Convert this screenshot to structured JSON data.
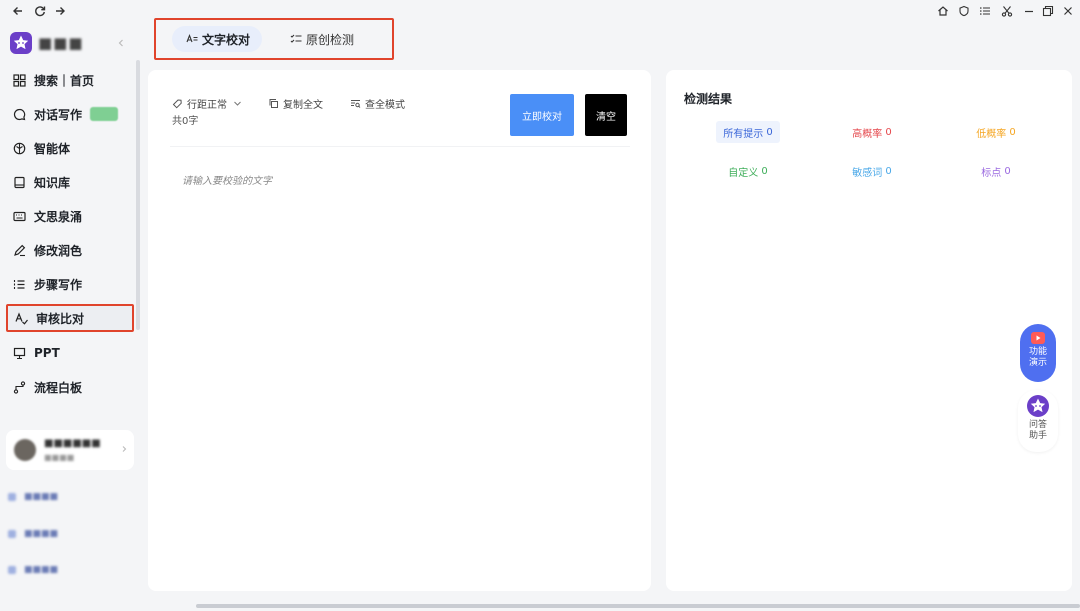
{
  "sidebar": {
    "items": [
      {
        "label": "搜索｜首页",
        "icon": "grid-icon"
      },
      {
        "label": "对话写作",
        "icon": "chat-icon"
      },
      {
        "label": "智能体",
        "icon": "globe-icon"
      },
      {
        "label": "知识库",
        "icon": "book-icon"
      },
      {
        "label": "文思泉涌",
        "icon": "keyboard-icon"
      },
      {
        "label": "修改润色",
        "icon": "pen-icon"
      },
      {
        "label": "步骤写作",
        "icon": "list-icon"
      },
      {
        "label": "审核比对",
        "icon": "text-check-icon"
      },
      {
        "label": "PPT",
        "icon": "presentation-icon"
      },
      {
        "label": "流程白板",
        "icon": "flow-icon"
      }
    ]
  },
  "tabs": [
    {
      "label": "文字校对",
      "icon": "text-check-icon",
      "active": true
    },
    {
      "label": "原创检测",
      "icon": "checklist-icon",
      "active": false
    }
  ],
  "editor": {
    "line_spacing": "行距正常",
    "copy_all": "复制全文",
    "check_mode": "查全模式",
    "word_count": "共0字",
    "check_button": "立即校对",
    "clear_button": "清空",
    "placeholder": "请输入要校验的文字"
  },
  "results": {
    "title": "检测结果",
    "stats": [
      {
        "label": "所有提示",
        "count": "0",
        "color": "#3a66d8"
      },
      {
        "label": "高概率",
        "count": "0",
        "color": "#e5484d"
      },
      {
        "label": "低概率",
        "count": "0",
        "color": "#f5a623"
      },
      {
        "label": "自定义",
        "count": "0",
        "color": "#3fae5a"
      },
      {
        "label": "敏感词",
        "count": "0",
        "color": "#4aa8e8"
      },
      {
        "label": "标点",
        "count": "0",
        "color": "#9b6ae0"
      }
    ]
  },
  "floating": {
    "demo_line1": "功能",
    "demo_line2": "演示",
    "help_line1": "问答",
    "help_line2": "助手"
  },
  "colors": {
    "accent": "#4a8ff7",
    "highlight_border": "#e0442c",
    "demo_bg": "#4f6ff0"
  }
}
